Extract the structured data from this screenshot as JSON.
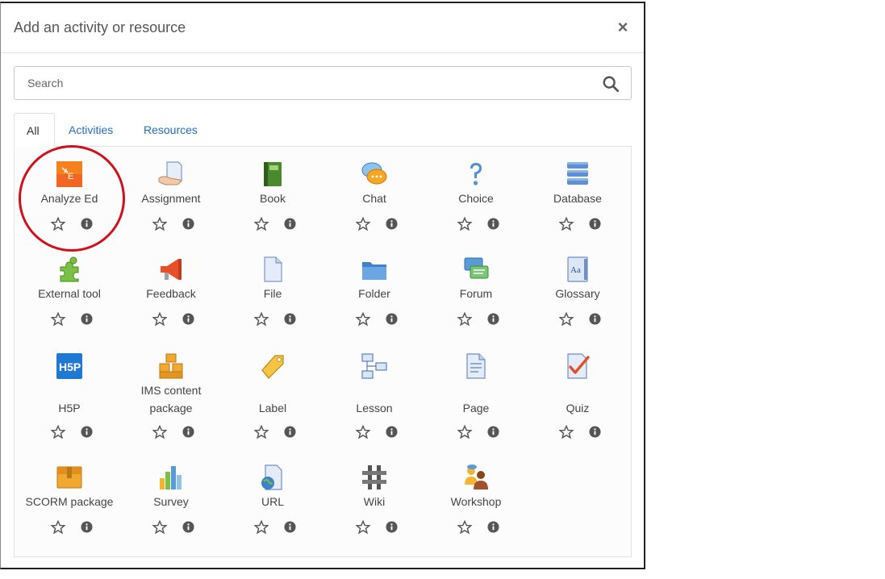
{
  "dialog": {
    "title": "Add an activity or resource",
    "close_glyph": "×"
  },
  "search": {
    "placeholder": "Search",
    "value": ""
  },
  "tabs": [
    {
      "label": "All",
      "active": true
    },
    {
      "label": "Activities",
      "active": false
    },
    {
      "label": "Resources",
      "active": false
    }
  ],
  "modules": [
    {
      "label": "Analyze Ed",
      "icon": "analyze-ed-icon"
    },
    {
      "label": "Assignment",
      "icon": "assignment-icon"
    },
    {
      "label": "Book",
      "icon": "book-icon"
    },
    {
      "label": "Chat",
      "icon": "chat-icon"
    },
    {
      "label": "Choice",
      "icon": "choice-icon"
    },
    {
      "label": "Database",
      "icon": "database-icon"
    },
    {
      "label": "External tool",
      "icon": "external-tool-icon"
    },
    {
      "label": "Feedback",
      "icon": "feedback-icon"
    },
    {
      "label": "File",
      "icon": "file-icon"
    },
    {
      "label": "Folder",
      "icon": "folder-icon"
    },
    {
      "label": "Forum",
      "icon": "forum-icon"
    },
    {
      "label": "Glossary",
      "icon": "glossary-icon"
    },
    {
      "label": "H5P",
      "icon": "h5p-icon"
    },
    {
      "label": "IMS content package",
      "icon": "ims-package-icon"
    },
    {
      "label": "Label",
      "icon": "label-icon"
    },
    {
      "label": "Lesson",
      "icon": "lesson-icon"
    },
    {
      "label": "Page",
      "icon": "page-icon"
    },
    {
      "label": "Quiz",
      "icon": "quiz-icon"
    },
    {
      "label": "SCORM package",
      "icon": "scorm-icon"
    },
    {
      "label": "Survey",
      "icon": "survey-icon"
    },
    {
      "label": "URL",
      "icon": "url-icon"
    },
    {
      "label": "Wiki",
      "icon": "wiki-icon"
    },
    {
      "label": "Workshop",
      "icon": "workshop-icon"
    }
  ],
  "colors": {
    "link": "#1f6fbf",
    "highlight": "#d0101d",
    "icon_gray": "#555555"
  }
}
